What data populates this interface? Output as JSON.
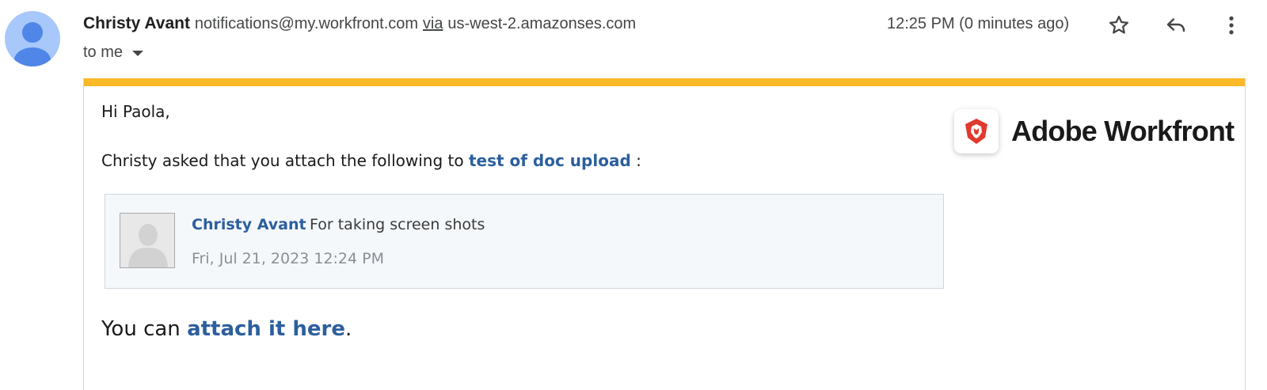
{
  "header": {
    "sender_name": "Christy Avant",
    "sender_email": "notifications@my.workfront.com",
    "via_label": "via",
    "relay_domain": "us-west-2.amazonses.com",
    "recipient_label": "to me",
    "timestamp": "12:25 PM (0 minutes ago)",
    "icons": [
      "avatar-icon",
      "star-icon",
      "reply-icon",
      "more-vert-icon",
      "chevron-down-icon"
    ]
  },
  "email": {
    "accent_color": "#fbb827",
    "link_color": "#2c5f9e",
    "brand_name": "Adobe Workfront",
    "brand_logo_color": "#e03a2e",
    "greeting": "Hi Paola,",
    "request_prefix": "Christy asked that you attach the following to",
    "request_link": "test of doc upload",
    "request_suffix": ":",
    "note": {
      "author": "Christy Avant",
      "text": "For taking screen shots",
      "date": "Fri, Jul 21, 2023 12:24 PM"
    },
    "attach_prefix": "You can",
    "attach_link": "attach it here",
    "attach_suffix": "."
  }
}
